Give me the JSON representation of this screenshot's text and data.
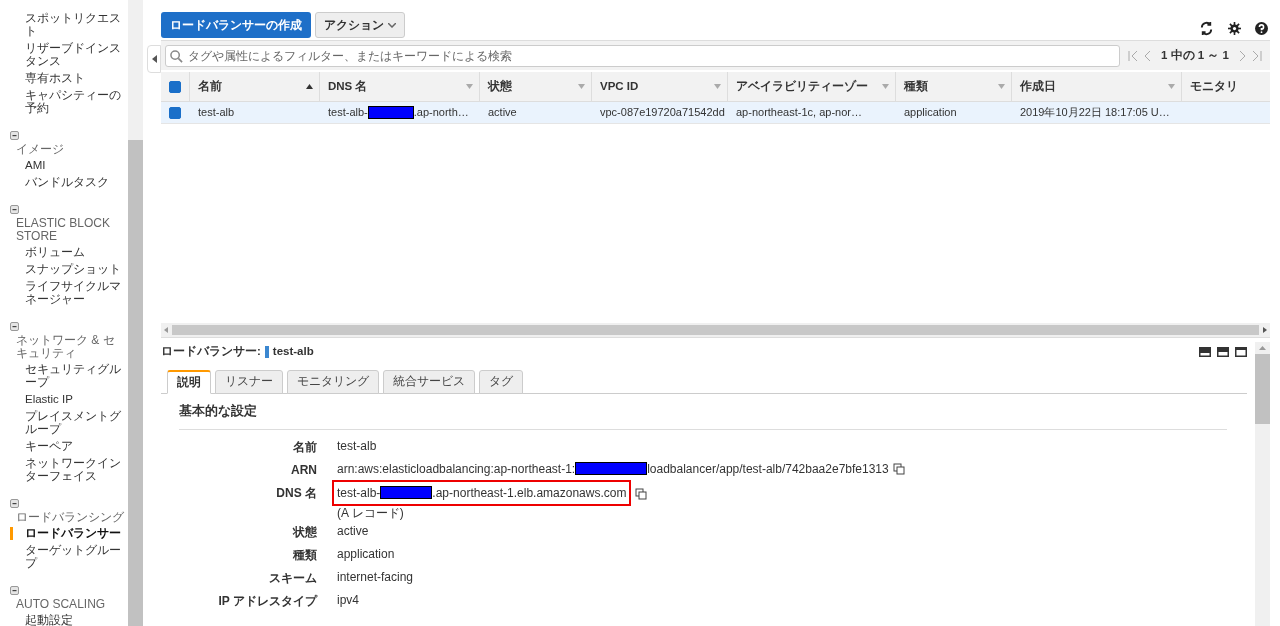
{
  "sidebar": {
    "sections": [
      {
        "items": [
          {
            "label": "スポットリクエスト",
            "selected": false
          },
          {
            "label": "リザーブドインスタンス",
            "selected": false
          },
          {
            "label": "専有ホスト",
            "selected": false
          },
          {
            "label": "キャパシティーの予約",
            "selected": false
          }
        ]
      },
      {
        "heading": "イメージ",
        "expanded": true,
        "items": [
          {
            "label": "AMI",
            "selected": false
          },
          {
            "label": "バンドルタスク",
            "selected": false
          }
        ]
      },
      {
        "heading": "ELASTIC BLOCK STORE",
        "expanded": true,
        "items": [
          {
            "label": "ボリューム",
            "selected": false
          },
          {
            "label": "スナップショット",
            "selected": false
          },
          {
            "label": "ライフサイクルマネージャー",
            "selected": false
          }
        ]
      },
      {
        "heading": "ネットワーク & セキュリティ",
        "expanded": true,
        "items": [
          {
            "label": "セキュリティグループ",
            "selected": false
          },
          {
            "label": "Elastic IP",
            "selected": false
          },
          {
            "label": "プレイスメントグループ",
            "selected": false
          },
          {
            "label": "キーペア",
            "selected": false
          },
          {
            "label": "ネットワークインターフェイス",
            "selected": false
          }
        ]
      },
      {
        "heading": "ロードバランシング",
        "expanded": true,
        "items": [
          {
            "label": "ロードバランサー",
            "selected": true
          },
          {
            "label": "ターゲットグループ",
            "selected": false
          }
        ]
      },
      {
        "heading": "AUTO SCALING",
        "expanded": true,
        "items": [
          {
            "label": "起動設定",
            "selected": false
          }
        ]
      }
    ]
  },
  "toolbar": {
    "create_button": "ロードバランサーの作成",
    "actions_button": "アクション"
  },
  "filter": {
    "placeholder": "タグや属性によるフィルター、またはキーワードによる検索"
  },
  "pagination": "1 中の 1 ～ 1",
  "table": {
    "select_all": true,
    "columns": [
      {
        "label": "名前",
        "sorted": true
      },
      {
        "label": "DNS 名",
        "sorted": false
      },
      {
        "label": "状態",
        "sorted": false
      },
      {
        "label": "VPC ID",
        "sorted": false
      },
      {
        "label": "アベイラビリティーゾー",
        "sorted": false
      },
      {
        "label": "種類",
        "sorted": false
      },
      {
        "label": "作成日",
        "sorted": false
      },
      {
        "label": "モニタリ"
      }
    ],
    "rows": [
      {
        "selected": true,
        "cells": [
          {
            "text": "test-alb"
          },
          {
            "text": "test-alb-",
            "redacted": true,
            "after": ".ap-north…"
          },
          {
            "text": "active"
          },
          {
            "text": "vpc-087e19720a71542dd"
          },
          {
            "text": "ap-northeast-1c, ap-nor…"
          },
          {
            "text": "application"
          },
          {
            "text": "2019年10月22日 18:17:05 U…"
          }
        ]
      }
    ]
  },
  "detail": {
    "title_label": "ロードバランサー:",
    "title_name": "test-alb",
    "tabs": [
      {
        "label": "説明",
        "selected": true
      },
      {
        "label": "リスナー",
        "selected": false
      },
      {
        "label": "モニタリング",
        "selected": false
      },
      {
        "label": "統合サービス",
        "selected": false
      },
      {
        "label": "タグ",
        "selected": false
      }
    ],
    "section_title": "基本的な設定",
    "fields": [
      {
        "label": "名前",
        "value": "test-alb"
      },
      {
        "label": "ARN",
        "value": "arn:aws:elasticloadbalancing:ap-northeast-1:",
        "redacted": true,
        "after": "loadbalancer/app/test-alb/742baa2e7bfe1313",
        "copy": true
      },
      {
        "label": "DNS 名",
        "value": "test-alb-",
        "redacted": true,
        "after": ".ap-northeast-1.elb.amazonaws.com",
        "copy": true,
        "highlighted": true,
        "note": "(A レコード)"
      },
      {
        "label": "状態",
        "value": "active"
      },
      {
        "label": "種類",
        "value": "application"
      },
      {
        "label": "スキーム",
        "value": "internet-facing"
      },
      {
        "label": "IP アドレスタイプ",
        "value": "ipv4"
      }
    ]
  }
}
